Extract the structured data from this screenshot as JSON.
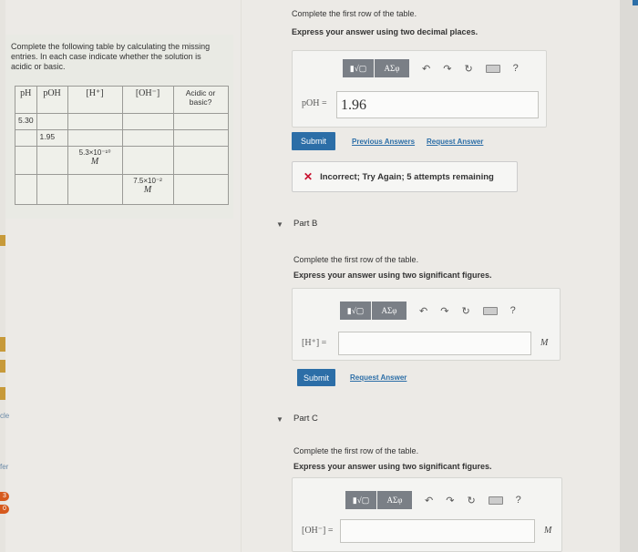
{
  "left_strip": {
    "texts": [
      "cle",
      "fer"
    ],
    "badges": [
      "3",
      "0"
    ]
  },
  "problem": {
    "instructions": "Complete the following table by calculating the missing entries. In each case indicate whether the solution is acidic or basic.",
    "table": {
      "headers": [
        "pH",
        "pOH",
        "[H⁺]",
        "[OH⁻]",
        "Acidic or basic?"
      ],
      "rows": [
        [
          "5.30",
          "",
          "",
          "",
          ""
        ],
        [
          "",
          "1.95",
          "",
          "",
          ""
        ],
        [
          "",
          "",
          "5.3×10⁻¹⁰",
          "",
          ""
        ],
        [
          "",
          "",
          "",
          "7.5×10⁻²",
          ""
        ]
      ],
      "unit": "M"
    }
  },
  "part_a": {
    "prompt": "Complete the first row of the table.",
    "instruction": "Express your answer using two decimal places.",
    "toolbar": {
      "templates": "▮√▢",
      "greek": "ΑΣφ",
      "help": "?"
    },
    "label": "pOH =",
    "value": "1.96",
    "submit": "Submit",
    "previous_answers": "Previous Answers",
    "request_answer": "Request Answer",
    "feedback": "Incorrect; Try Again; 5 attempts remaining"
  },
  "part_b": {
    "title": "Part B",
    "prompt": "Complete the first row of the table.",
    "instruction": "Express your answer using two significant figures.",
    "toolbar": {
      "templates": "▮√▢",
      "greek": "ΑΣφ",
      "help": "?"
    },
    "label": "[H⁺] =",
    "value": "",
    "unit": "M",
    "submit": "Submit",
    "request_answer": "Request Answer"
  },
  "part_c": {
    "title": "Part C",
    "prompt": "Complete the first row of the table.",
    "instruction": "Express your answer using two significant figures.",
    "toolbar": {
      "templates": "▮√▢",
      "greek": "ΑΣφ",
      "help": "?"
    },
    "label": "[OH⁻] =",
    "value": "",
    "unit": "M"
  }
}
